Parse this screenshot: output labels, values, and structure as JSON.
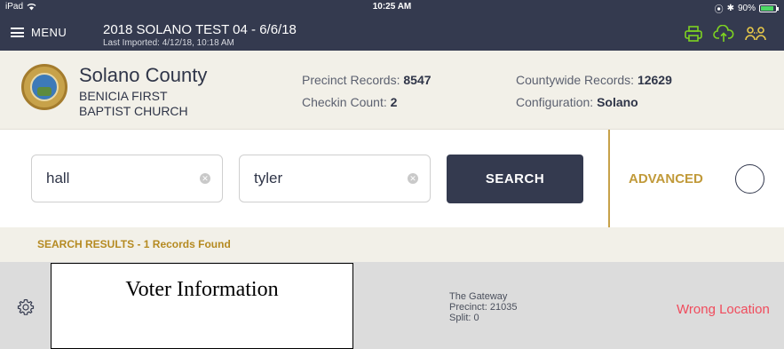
{
  "status_bar": {
    "device": "iPad",
    "time": "10:25 AM",
    "battery": "90%",
    "battery_level": 0.9
  },
  "app_bar": {
    "menu_label": "MENU",
    "election_title": "2018 SOLANO TEST 04 - 6/6/18",
    "last_imported": "Last Imported: 4/12/18, 10:18 AM",
    "icons": [
      "printer-icon",
      "cloud-upload-icon",
      "pollworkers-icon"
    ]
  },
  "county": {
    "name": "Solano County",
    "location_line1": "BENICIA FIRST",
    "location_line2": "BAPTIST CHURCH",
    "precinct_label": "Precinct Records:",
    "precinct_value": "8547",
    "checkin_label": "Checkin Count:",
    "checkin_value": "2",
    "countywide_label": "Countywide Records:",
    "countywide_value": "12629",
    "config_label": "Configuration:",
    "config_value": "Solano"
  },
  "search": {
    "last_name": "hall",
    "first_name": "tyler",
    "button_label": "SEARCH",
    "advanced_label": "ADVANCED"
  },
  "results": {
    "header": "SEARCH RESULTS - 1 Records Found",
    "rows": [
      {
        "voter_info": "Voter Information",
        "location": "The Gateway",
        "precinct": "Precinct: 21035",
        "split": "Split: 0",
        "status": "Wrong Location"
      }
    ]
  },
  "colors": {
    "navy": "#343a4f",
    "gold": "#c19a3a",
    "green": "#7ed321",
    "error": "#f04b5c",
    "beige": "#f2f0e8"
  }
}
